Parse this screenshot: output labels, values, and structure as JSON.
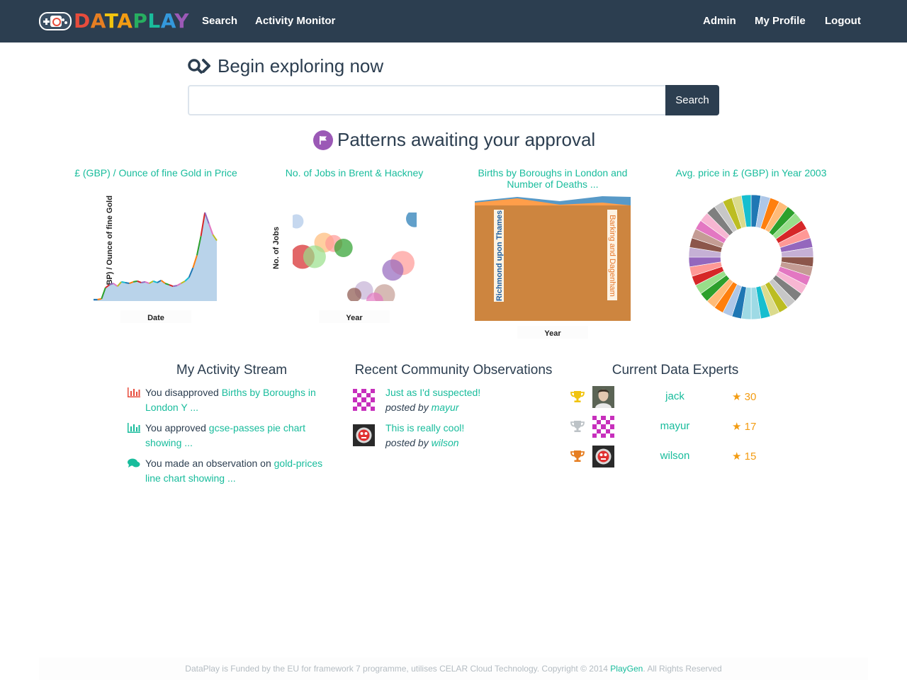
{
  "nav": {
    "brand": "DATAPLAY",
    "links_left": [
      "Search",
      "Activity Monitor"
    ],
    "links_right": [
      "Admin",
      "My Profile",
      "Logout"
    ]
  },
  "search": {
    "heading": "Begin exploring now",
    "input_value": "",
    "button_label": "Search"
  },
  "patterns": {
    "heading": "Patterns awaiting your approval",
    "cards": [
      {
        "title": "£ (GBP) / Ounce of fine Gold in Price",
        "xlabel": "Date",
        "ylabel": "£ (GBP) / Ounce of fine Gold"
      },
      {
        "title": "No. of Jobs in Brent & Hackney",
        "xlabel": "Year",
        "ylabel": "No. of Jobs"
      },
      {
        "title": "Births by Boroughs in London and Number of Deaths ...",
        "xlabel": "Year",
        "labels": [
          "Richmond upon Thames",
          "Barking and Dagenham"
        ]
      },
      {
        "title": "Avg. price in £ (GBP) in Year 2003"
      }
    ]
  },
  "chart_data": [
    {
      "type": "area",
      "title": "£ (GBP) / Ounce of fine Gold in Price",
      "xlabel": "Date",
      "ylabel": "£ (GBP) / Ounce of fine Gold",
      "values": [
        2,
        2,
        3,
        18,
        22,
        24,
        20,
        26,
        25,
        24,
        26,
        27,
        25,
        26,
        24,
        27,
        25,
        28,
        24,
        22,
        20,
        21,
        24,
        27,
        32,
        45,
        62,
        88,
        120,
        105,
        90,
        82
      ]
    },
    {
      "type": "scatter",
      "title": "No. of Jobs in Brent & Hackney",
      "xlabel": "Year",
      "ylabel": "No. of Jobs",
      "points": [
        {
          "x": 0.02,
          "y": 0.9,
          "r": 10,
          "color": "#aec7e8"
        },
        {
          "x": 0.25,
          "y": 0.66,
          "r": 14,
          "color": "#ffbb78"
        },
        {
          "x": 0.33,
          "y": 0.65,
          "r": 12,
          "color": "#ff9896"
        },
        {
          "x": 0.41,
          "y": 0.6,
          "r": 13,
          "color": "#2ca02c"
        },
        {
          "x": 0.07,
          "y": 0.5,
          "r": 17,
          "color": "#d62728"
        },
        {
          "x": 0.17,
          "y": 0.5,
          "r": 16,
          "color": "#98df8a"
        },
        {
          "x": 1.0,
          "y": 0.93,
          "r": 12,
          "color": "#1f77b4"
        },
        {
          "x": 0.9,
          "y": 0.43,
          "r": 17,
          "color": "#ff9896"
        },
        {
          "x": 0.82,
          "y": 0.35,
          "r": 15,
          "color": "#9467bd"
        },
        {
          "x": 0.58,
          "y": 0.12,
          "r": 13,
          "color": "#c5b0d5"
        },
        {
          "x": 0.5,
          "y": 0.07,
          "r": 10,
          "color": "#8c564b"
        },
        {
          "x": 0.75,
          "y": 0.07,
          "r": 15,
          "color": "#c49c94"
        },
        {
          "x": 0.67,
          "y": 0.0,
          "r": 12,
          "color": "#e377c2"
        }
      ]
    },
    {
      "type": "area",
      "title": "Births by Boroughs in London and Number of Deaths ...",
      "xlabel": "Year",
      "series": [
        {
          "name": "Richmond upon Thames",
          "color": "#ff7f0e"
        },
        {
          "name": "Barking and Dagenham",
          "color": "#1f77b4"
        }
      ]
    },
    {
      "type": "pie",
      "title": "Avg. price in £ (GBP) in Year 2003",
      "values": [
        1,
        1,
        1,
        1,
        1,
        1,
        1,
        1,
        1,
        1,
        1,
        1,
        1,
        1,
        1,
        1,
        1,
        1,
        1,
        1,
        1,
        1,
        1,
        1,
        1,
        1,
        1,
        1,
        1,
        1,
        1,
        1,
        1,
        1,
        1,
        1,
        1,
        1,
        1,
        1
      ],
      "colors": [
        "#1f77b4",
        "#aec7e8",
        "#ff7f0e",
        "#ffbb78",
        "#2ca02c",
        "#98df8a",
        "#d62728",
        "#ff9896",
        "#9467bd",
        "#c5b0d5",
        "#8c564b",
        "#c49c94",
        "#e377c2",
        "#f7b6d2",
        "#7f7f7f",
        "#c7c7c7",
        "#bcbd22",
        "#dbdb8d",
        "#17becf",
        "#9edae5",
        "#9edae5",
        "#1f77b4",
        "#aec7e8",
        "#ff7f0e",
        "#ffbb78",
        "#2ca02c",
        "#98df8a",
        "#d62728",
        "#ff9896",
        "#9467bd",
        "#c5b0d5",
        "#8c564b",
        "#c49c94",
        "#e377c2",
        "#f7b6d2",
        "#7f7f7f",
        "#c7c7c7",
        "#bcbd22",
        "#dbdb8d",
        "#17becf"
      ]
    }
  ],
  "activity": {
    "heading": "My Activity Stream",
    "items": [
      {
        "prefix": "You disapproved ",
        "link": "Births by Boroughs in London Y ...",
        "icon": "bar-chart-icon",
        "icon_color": "#e74c3c"
      },
      {
        "prefix": "You approved ",
        "link": "gcse-passes pie chart showing ...",
        "icon": "bar-chart-icon",
        "icon_color": "#18bc9c"
      },
      {
        "prefix": "You made an observation on ",
        "link": "gold-prices line chart showing ...",
        "icon": "comments-icon",
        "icon_color": "#18bc9c"
      }
    ]
  },
  "observations": {
    "heading": "Recent Community Observations",
    "items": [
      {
        "text": "Just as I'd suspected!",
        "posted_by": "posted by ",
        "user": "mayur"
      },
      {
        "text": "This is really cool!",
        "posted_by": "posted by ",
        "user": "wilson"
      }
    ]
  },
  "experts": {
    "heading": "Current Data Experts",
    "rows": [
      {
        "name": "jack",
        "score": "30",
        "trophy_color": "#f1c40f"
      },
      {
        "name": "mayur",
        "score": "17",
        "trophy_color": "#bdc3c7"
      },
      {
        "name": "wilson",
        "score": "15",
        "trophy_color": "#e67e22"
      }
    ]
  },
  "footer": {
    "text": "DataPlay is Funded by the EU for framework 7 programme, utilises CELAR Cloud Technology. Copyright © 2014 ",
    "link": "PlayGen",
    "suffix": ". All Rights Reserved"
  }
}
